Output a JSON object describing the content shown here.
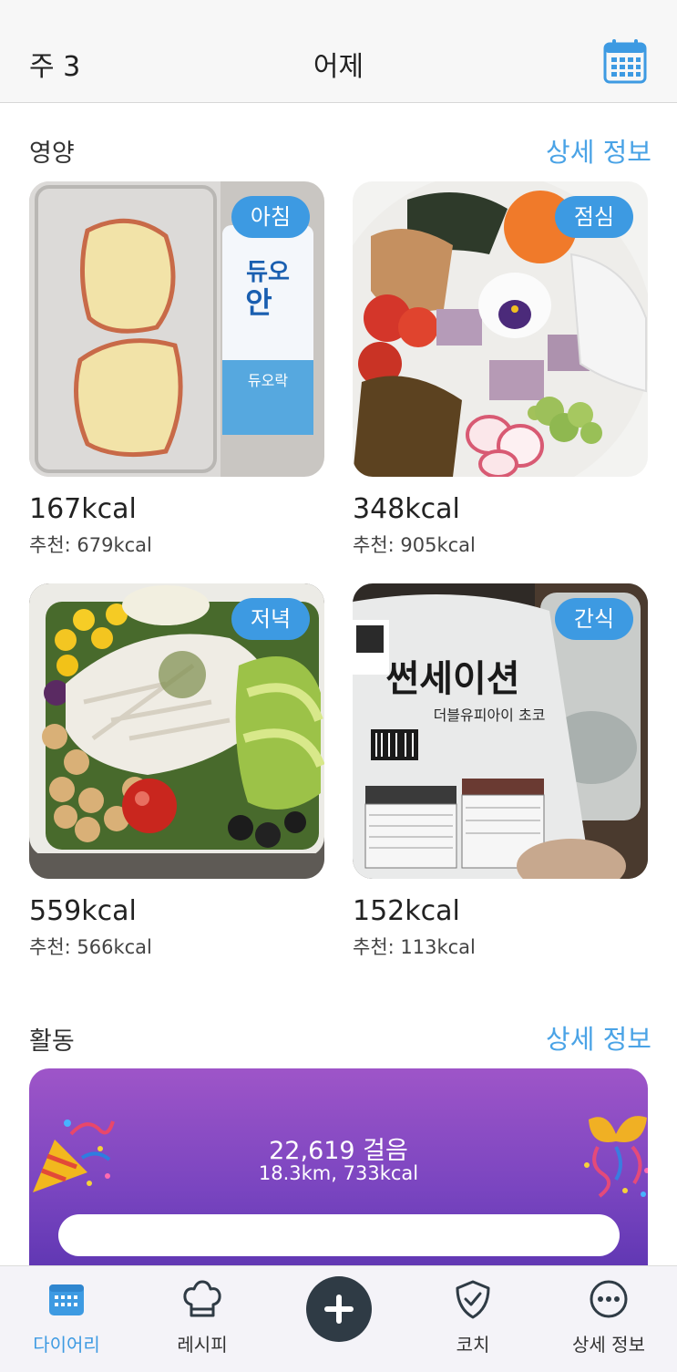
{
  "header": {
    "week": "주 3",
    "title": "어제",
    "calendar_icon": "calendar-icon"
  },
  "nutrition": {
    "title": "영양",
    "details_link": "상세 정보",
    "meals": [
      {
        "badge": "아침",
        "kcal": "167kcal",
        "recommended": "추천: 679kcal"
      },
      {
        "badge": "점심",
        "kcal": "348kcal",
        "recommended": "추천: 905kcal"
      },
      {
        "badge": "저녁",
        "kcal": "559kcal",
        "recommended": "추천: 566kcal"
      },
      {
        "badge": "간식",
        "kcal": "152kcal",
        "recommended": "추천: 113kcal"
      }
    ]
  },
  "activity": {
    "title": "활동",
    "details_link": "상세 정보",
    "steps": "22,619 걸음",
    "summary": "18.3km, 733kcal"
  },
  "tabbar": {
    "items": [
      {
        "label": "다이어리",
        "icon": "diary-calendar-icon"
      },
      {
        "label": "레시피",
        "icon": "chef-hat-icon"
      },
      {
        "label": "",
        "icon": "plus-icon"
      },
      {
        "label": "코치",
        "icon": "shield-check-icon"
      },
      {
        "label": "상세 정보",
        "icon": "more-icon"
      }
    ]
  },
  "colors": {
    "accent": "#3d9ae2",
    "link": "#4aa3e6",
    "activity_top": "#9e55c8",
    "activity_bottom": "#5a34b0"
  }
}
